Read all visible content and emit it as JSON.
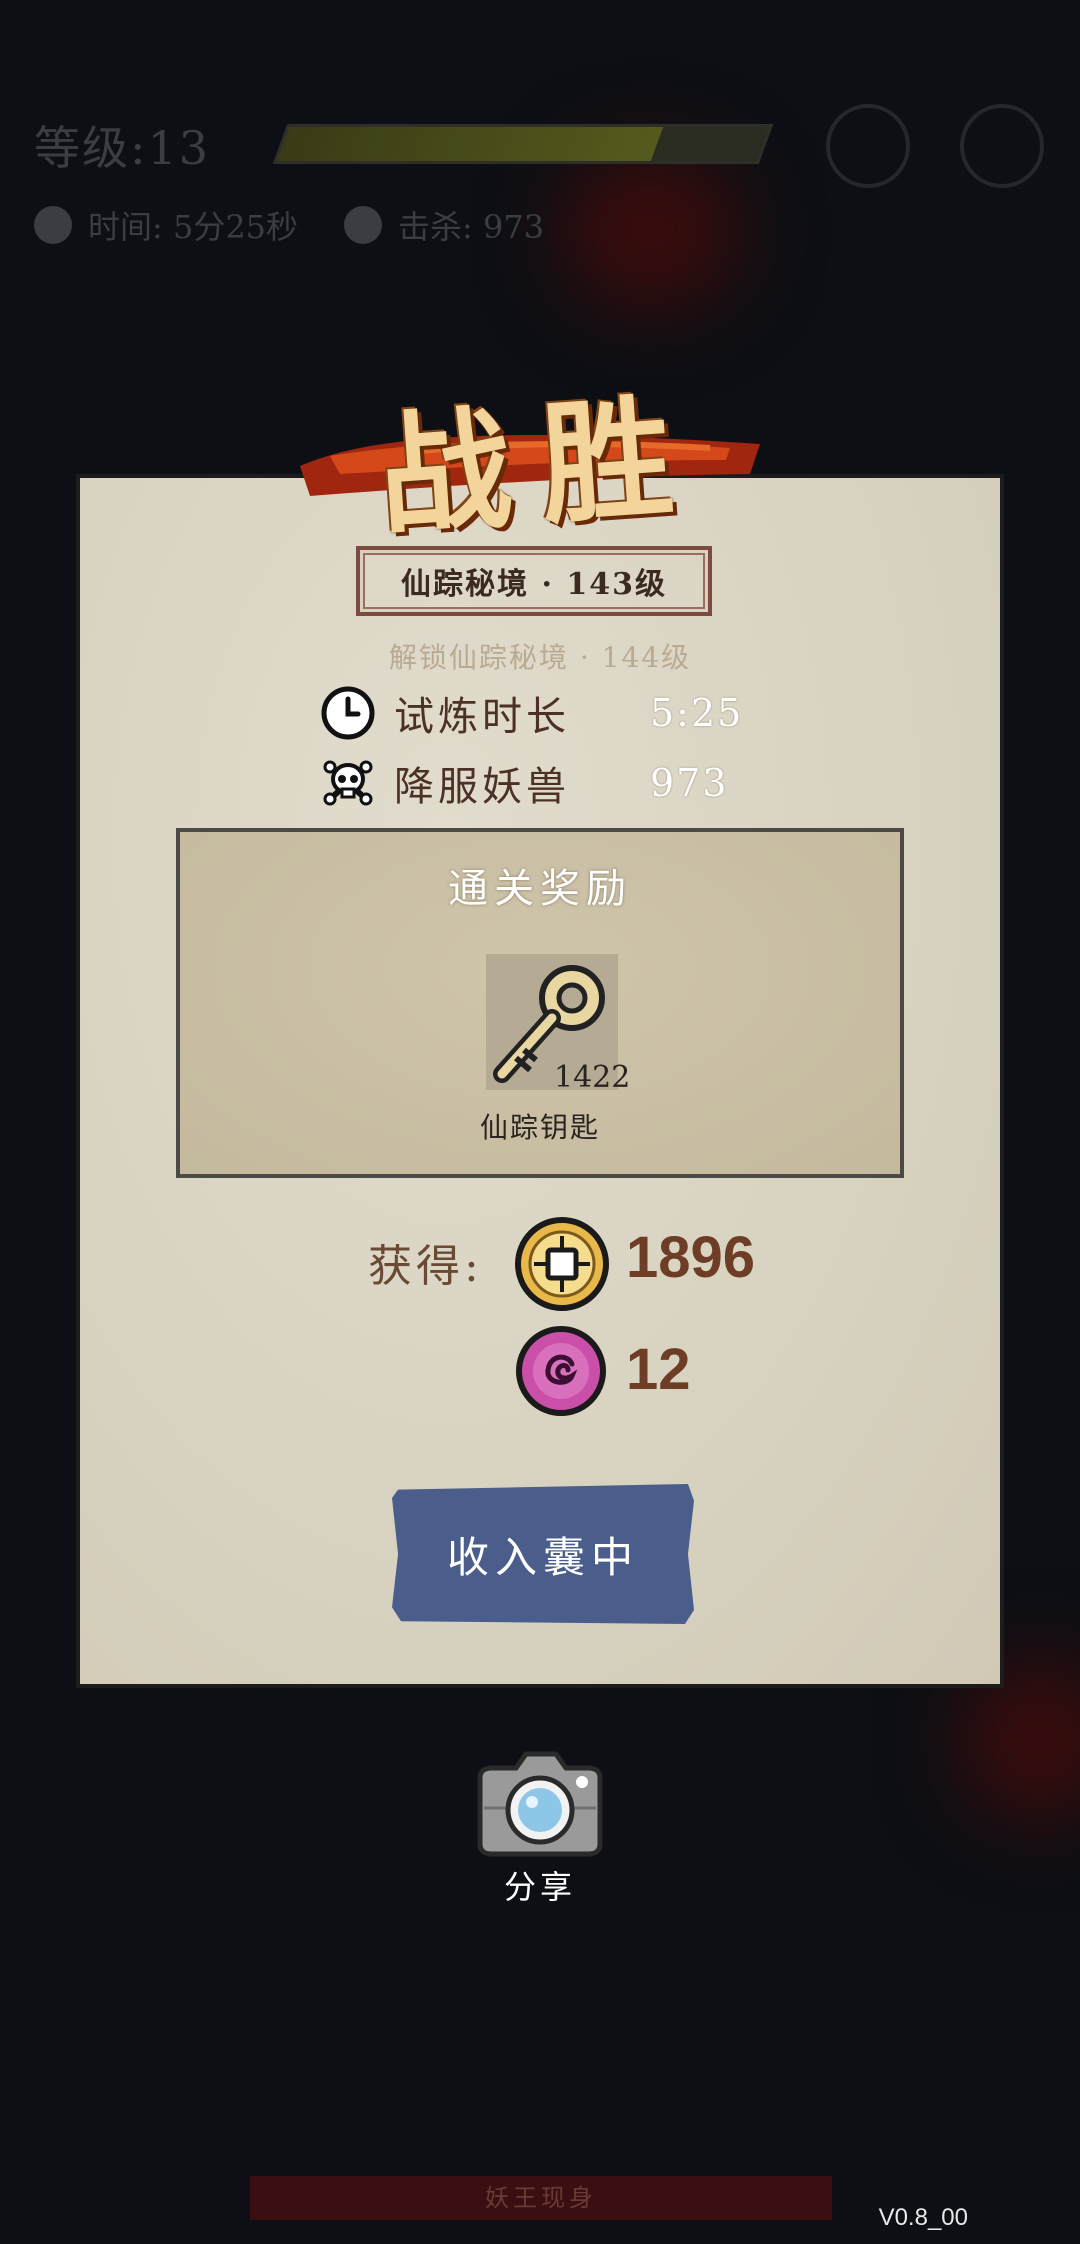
{
  "hud": {
    "level": "等级:13",
    "level_progress": 0.78,
    "time": "时间: 5分25秒",
    "kills": "击杀: 973"
  },
  "modal": {
    "title": "战胜",
    "stage": "仙踪秘境 · 143级",
    "unlock_hint": "解锁仙踪秘境 · 144级",
    "stats": [
      {
        "label": "试炼时长",
        "value": "5:25",
        "icon": "clock-icon"
      },
      {
        "label": "降服妖兽",
        "value": "973",
        "icon": "skull-icon"
      }
    ],
    "reward": {
      "title": "通关奖励",
      "item": {
        "name": "仙踪钥匙",
        "count": "1422",
        "icon": "key-icon"
      }
    },
    "gain": {
      "label": "获得:",
      "coins": "1896",
      "gems": "12"
    },
    "collect_button": "收入囊中"
  },
  "share": {
    "label": "分享",
    "icon": "camera-icon"
  },
  "bottom_bar": "妖王现身",
  "version": "V0.8_00",
  "colors": {
    "panel": "#dcd6c6",
    "button": "#4a5d8b",
    "accent_brown": "#6e3d26",
    "title_gold": "#f3d49a"
  }
}
